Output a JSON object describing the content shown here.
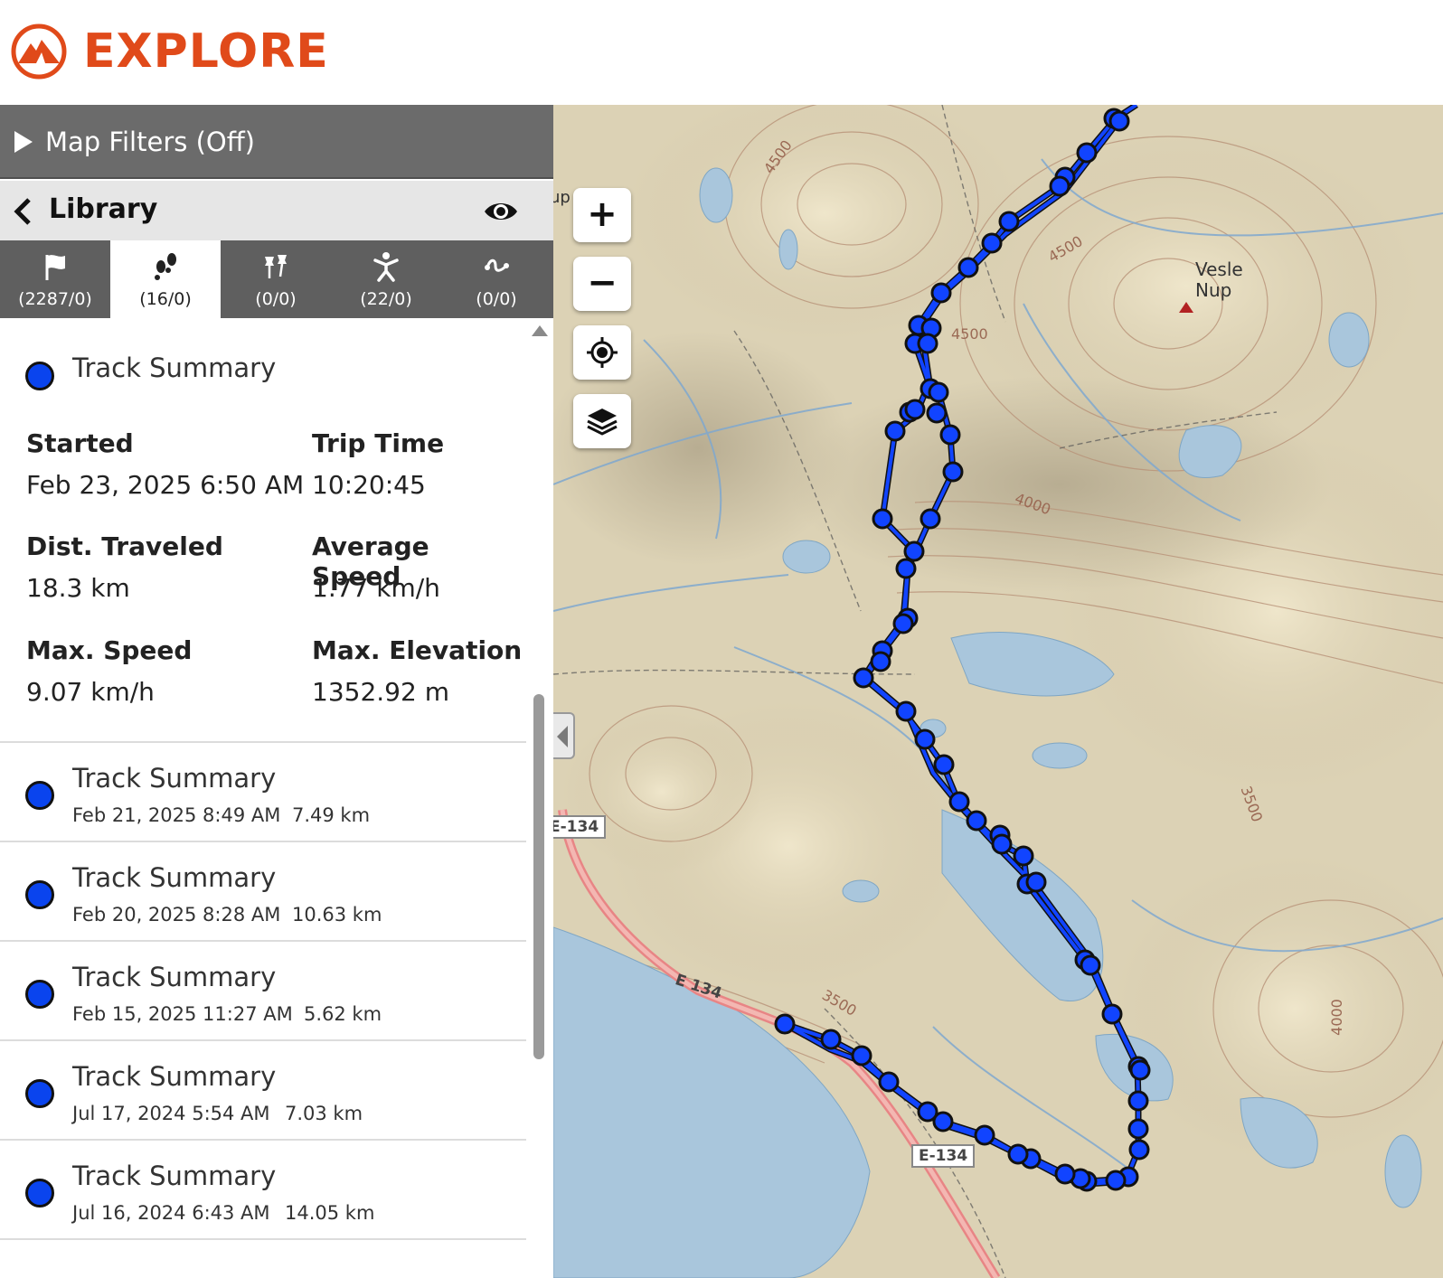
{
  "app": {
    "brand": "EXPLORE",
    "brand_color": "#e04a1a"
  },
  "filters": {
    "label": "Map Filters (Off)"
  },
  "library": {
    "title": "Library"
  },
  "tabs": [
    {
      "icon": "flag-icon",
      "count": "(2287/0)",
      "active": false
    },
    {
      "icon": "footsteps-icon",
      "count": "(16/0)",
      "active": true
    },
    {
      "icon": "pushpins-icon",
      "count": "(0/0)",
      "active": false
    },
    {
      "icon": "person-icon",
      "count": "(22/0)",
      "active": false
    },
    {
      "icon": "route-icon",
      "count": "(0/0)",
      "active": false
    }
  ],
  "selected_track": {
    "title": "Track Summary",
    "stats": {
      "started_label": "Started",
      "started_value": "Feb 23, 2025 6:50 AM",
      "trip_time_label": "Trip Time",
      "trip_time_value": "10:20:45",
      "dist_label": "Dist. Traveled",
      "dist_value": "18.3 km",
      "avg_speed_label": "Average Speed",
      "avg_speed_value": "1.77 km/h",
      "max_speed_label": "Max. Speed",
      "max_speed_value": "9.07 km/h",
      "max_elev_label": "Max. Elevation",
      "max_elev_value": "1352.92 m"
    }
  },
  "tracks": [
    {
      "title": "Track Summary",
      "date": "Feb 21, 2025 8:49 AM",
      "distance": "7.49 km"
    },
    {
      "title": "Track Summary",
      "date": "Feb 20, 2025 8:28 AM",
      "distance": "10.63 km"
    },
    {
      "title": "Track Summary",
      "date": "Feb 15, 2025 11:27 AM",
      "distance": "5.62 km"
    },
    {
      "title": "Track Summary",
      "date": "Jul 17, 2024 5:54 AM",
      "distance": "7.03 km"
    },
    {
      "title": "Track Summary",
      "date": "Jul 16, 2024 6:43 AM",
      "distance": "14.05 km"
    }
  ],
  "map": {
    "zoom_in": "+",
    "zoom_out": "−",
    "place_name_1": "Vesle",
    "place_name_2": "Nup",
    "partial_label": "up",
    "road_1": "E-134",
    "road_2": "E 134",
    "road_3": "E-134",
    "contours": [
      "4500",
      "4500",
      "4500",
      "4000",
      "3500",
      "3500",
      "4000"
    ],
    "track_color": "#0a44ee"
  }
}
